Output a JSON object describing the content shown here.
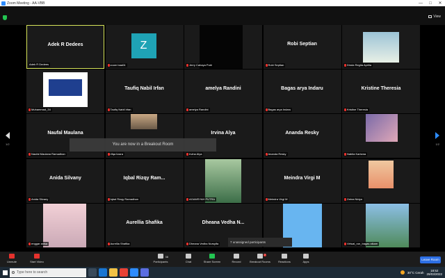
{
  "titlebar": {
    "title": "Zoom Meeting - AA-VBB",
    "minimize": "—",
    "maximize": "□",
    "close": "✕"
  },
  "topbar": {
    "view_label": "View"
  },
  "tiles": [
    {
      "name": "Adek R Dedees",
      "label": "Adek R Dedees",
      "kind": "name",
      "active": true
    },
    {
      "name": "",
      "label": "zoom baa04",
      "kind": "avatar-z",
      "avatar": "Z"
    },
    {
      "name": "",
      "label": "Jerry Cahaya Putri",
      "kind": "black-photo"
    },
    {
      "name": "Robi Septian",
      "label": "Robi Septian",
      "kind": "name"
    },
    {
      "name": "",
      "label": "Dinda Regita Aprilia",
      "kind": "photo-dinda"
    },
    {
      "name": "",
      "label": "Muhammad_34",
      "kind": "logo"
    },
    {
      "name": "Taufiq Nabil Irfan",
      "label": "Taufiq Nabil Irfan",
      "kind": "name"
    },
    {
      "name": "amelya Randini",
      "label": "amelya Randini",
      "kind": "name"
    },
    {
      "name": "Bagas arya Indaru",
      "label": "Bagas arya Indaru",
      "kind": "name"
    },
    {
      "name": "Kristine Theresia",
      "label": "Kristine Theresia",
      "kind": "name"
    },
    {
      "name": "Naufal Maulana",
      "label": "Naufal Maulana Ramadhan",
      "kind": "name"
    },
    {
      "name": "",
      "label": "rifqa lizara",
      "kind": "photo-rifqa"
    },
    {
      "name": "Irvina Alya",
      "label": "Irvina Alya",
      "kind": "name"
    },
    {
      "name": "Ananda Resky",
      "label": "Ananda Resky",
      "kind": "name"
    },
    {
      "name": "",
      "label": "Nabila Karisma",
      "kind": "photo-nabila"
    },
    {
      "name": "Anida Silvany",
      "label": "Anida Silvany",
      "kind": "name"
    },
    {
      "name": "Iqbal Rizqy Ram...",
      "label": "Iqbal Rizqy Ramadhan",
      "kind": "name"
    },
    {
      "name": "",
      "label": "AGAMSYAH PUTRA",
      "kind": "photo-agam"
    },
    {
      "name": "Meindra Virgi M",
      "label": "Meindra Virgi M",
      "kind": "name"
    },
    {
      "name": "",
      "label": "Zahra Nidya",
      "kind": "photo-zahra"
    },
    {
      "name": "",
      "label": "enggar anisa",
      "kind": "photo-enggar"
    },
    {
      "name": "Aurellia Shafika",
      "label": "Aurellia Shafika",
      "kind": "name"
    },
    {
      "name": "Dheana Vedha N...",
      "label": "Dheana Vedha Nursyifa",
      "kind": "name"
    },
    {
      "name": "",
      "label": "",
      "kind": "photo-blue"
    },
    {
      "name": "",
      "label": "Virtual_run_bagas aikam",
      "kind": "photo-virtual"
    }
  ],
  "pager": {
    "left": "1/2",
    "right": "1/2"
  },
  "toast": "You are now in a Breakout Room",
  "popup": "7 unassigned participants",
  "toolbar": {
    "unmute": "Unmute",
    "start_video": "Start Video",
    "participants": "Participants",
    "participants_count": "38",
    "chat": "Chat",
    "share_screen": "Share Screen",
    "record": "Record",
    "breakout_rooms": "Breakout Rooms",
    "breakout_badge": "7",
    "reactions": "Reactions",
    "apps": "Apps",
    "leave": "Leave Room"
  },
  "taskbar": {
    "search_placeholder": "Type here to search",
    "weather": "30°C Cerah",
    "time": "18:52",
    "date": "29/03/2022"
  }
}
